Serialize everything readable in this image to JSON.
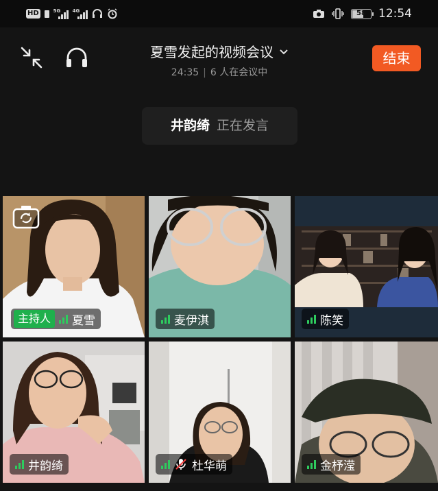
{
  "status_bar": {
    "hd_badge": "HD",
    "net1": "5G",
    "net2": "4G",
    "battery": "58",
    "time": "12:54"
  },
  "header": {
    "title": "夏雪发起的视频会议",
    "duration": "24:35",
    "participants": "6 人在会议中",
    "end_button": "结束"
  },
  "speaker": {
    "name": "井韵绮",
    "status": "正在发言"
  },
  "participants": [
    {
      "name": "夏雪",
      "host_tag": "主持人"
    },
    {
      "name": "麦伊淇"
    },
    {
      "name": "陈笑"
    },
    {
      "name": "井韵绮"
    },
    {
      "name": "杜华萌",
      "mic_muted": true
    },
    {
      "name": "金杼滢"
    }
  ],
  "colors": {
    "accent": "#f25a23",
    "active": "#1fb04c",
    "signal": "#2ecc5e"
  }
}
